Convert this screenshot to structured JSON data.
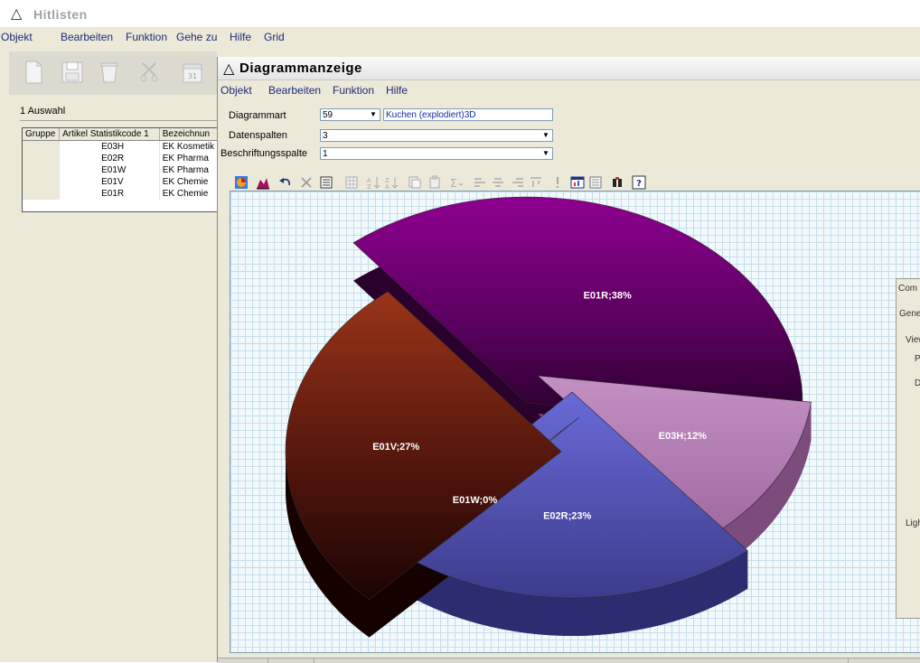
{
  "main_window": {
    "title": "Hitlisten",
    "menu": [
      "Objekt",
      "Bearbeiten",
      "Funktion",
      "Gehe zu",
      "Hilfe",
      "Grid"
    ]
  },
  "left_panel": {
    "tab_label": "1 Auswahl",
    "grid": {
      "columns": [
        "Gruppe",
        "Artikel Statistikcode 1",
        "Bezeichnun"
      ],
      "rows": [
        [
          "",
          "E03H",
          "EK Kosmetik"
        ],
        [
          "",
          "E02R",
          "EK Pharma"
        ],
        [
          "",
          "E01W",
          "EK Pharma"
        ],
        [
          "",
          "E01V",
          "EK Chemie"
        ],
        [
          "",
          "E01R",
          "EK Chemie"
        ]
      ]
    }
  },
  "diagram_window": {
    "title": "Diagrammanzeige",
    "menu": [
      "Objekt",
      "Bearbeiten",
      "Funktion",
      "Hilfe"
    ],
    "fields": {
      "chart_type_label": "Diagrammart",
      "chart_type_value": "59",
      "chart_type_desc": "Kuchen (explodiert)3D",
      "data_columns_label": "Datenspalten",
      "data_columns_value": "3",
      "label_column_label": "Beschriftungsspalte",
      "label_column_value": "1"
    },
    "side_panel_fragments": [
      "Com",
      "Gene",
      "View",
      "Pr",
      "De",
      "Ligh"
    ]
  },
  "colors": {
    "E01R": "#6e0070",
    "E03H": "#b07ab0",
    "E02R": "#5a5ac0",
    "E01W": "#f0f0a0",
    "E01V": "#8c2a18"
  },
  "chart_data": {
    "type": "pie",
    "title": "",
    "labels": [
      "E01R;38%",
      "E03H;12%",
      "E02R;23%",
      "E01W;0%",
      "E01V;27%"
    ],
    "categories": [
      "E01R",
      "E03H",
      "E02R",
      "E01W",
      "E01V"
    ],
    "values": [
      38,
      12,
      23,
      0,
      27
    ],
    "exploded": true,
    "three_d": true,
    "grid": true
  }
}
